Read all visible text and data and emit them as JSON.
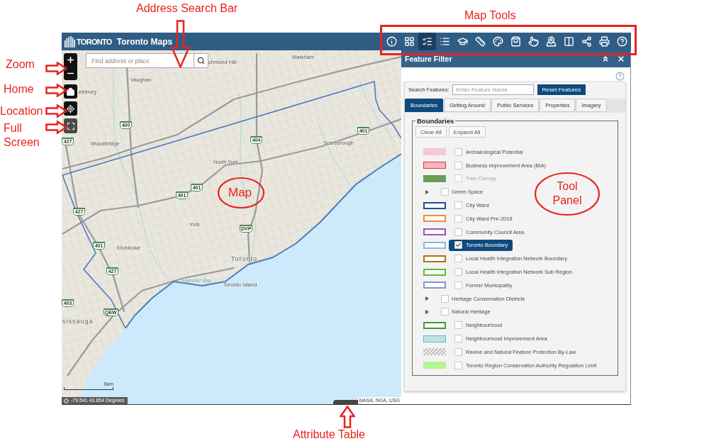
{
  "annotations": {
    "address_search_bar": "Address Search Bar",
    "map_tools": "Map Tools",
    "zoom": "Zoom",
    "home": "Home",
    "location": "Location",
    "full_screen": "Full Screen",
    "map": "Map",
    "tool_panel": "Tool Panel",
    "attribute_table": "Attribute Table"
  },
  "header": {
    "logo": "TORONTO",
    "title": "Toronto Maps",
    "tools": [
      {
        "selected": false
      },
      {
        "selected": false
      },
      {
        "selected": true
      },
      {
        "selected": false
      },
      {
        "selected": false
      },
      {
        "selected": false
      },
      {
        "selected": false
      },
      {
        "selected": false
      },
      {
        "selected": false
      },
      {
        "selected": false
      },
      {
        "selected": false
      },
      {
        "selected": false
      },
      {
        "selected": false
      },
      {
        "selected": false
      }
    ]
  },
  "map": {
    "search": {
      "placeholder": "Find address or place"
    },
    "labels": [
      {
        "text": "chmond Hill",
        "kind": "place"
      },
      {
        "text": "Markham",
        "kind": "place"
      },
      {
        "text": "Vaughan",
        "kind": "place"
      },
      {
        "text": "einburg",
        "kind": "place"
      },
      {
        "text": "Woodbridge",
        "kind": "place"
      },
      {
        "text": "North York",
        "kind": "place"
      },
      {
        "text": "Scarborough",
        "kind": "place"
      },
      {
        "text": "York",
        "kind": "place"
      },
      {
        "text": "Etobicoke",
        "kind": "place"
      },
      {
        "text": "Toronto",
        "kind": "city"
      },
      {
        "text": "Humber Bay",
        "kind": "water"
      },
      {
        "text": "Toronto Island",
        "kind": "place"
      },
      {
        "text": "sissauga",
        "kind": "city"
      }
    ],
    "shields": [
      {
        "text": "400"
      },
      {
        "text": "427"
      },
      {
        "text": "404"
      },
      {
        "text": "401"
      },
      {
        "text": "401"
      },
      {
        "text": "401"
      },
      {
        "text": "427"
      },
      {
        "text": "401"
      },
      {
        "text": "427"
      },
      {
        "text": "DVP"
      },
      {
        "text": "403"
      },
      {
        "text": "QEW"
      }
    ],
    "scale": "6km",
    "coordinates": "-79.541 43.854 Degrees",
    "attribution": "NASA, NGA, USG"
  },
  "feature_filter": {
    "title": "Feature Filter",
    "search_label": "Search Features:",
    "search": {
      "placeholder": "Enter Feature Name"
    },
    "reset_button": "Reset Features",
    "tabs": [
      {
        "label": "Boundaries",
        "selected": true
      },
      {
        "label": "Getting Around",
        "selected": false
      },
      {
        "label": "Public Services",
        "selected": false
      },
      {
        "label": "Properties",
        "selected": false
      },
      {
        "label": "Imagery",
        "selected": false
      }
    ],
    "section": {
      "legend": "Boundaries",
      "buttons": [
        "Clear All",
        "Expand All"
      ],
      "layers": [
        {
          "kind": "layer",
          "label": "Archaeological Potential",
          "swatch": {
            "kind": "fill",
            "color": "#f6c6dd"
          },
          "checked": false,
          "disabled": false
        },
        {
          "kind": "layer",
          "label": "Business Improvement Area (BIA)",
          "swatch": {
            "kind": "fill",
            "color": "#f7b4b9",
            "border": {
              "color": "#e0353c"
            }
          },
          "checked": false,
          "disabled": false
        },
        {
          "kind": "layer",
          "label": "Tree Canopy",
          "swatch": {
            "kind": "fill",
            "color": "#6a9c55"
          },
          "checked": false,
          "disabled": true
        },
        {
          "kind": "group",
          "label": "Green Space",
          "checked": false,
          "disabled": false,
          "expanded": false
        },
        {
          "kind": "layer",
          "label": "City Ward",
          "swatch": {
            "kind": "outline",
            "color": "#1d4f9c"
          },
          "checked": false,
          "disabled": false
        },
        {
          "kind": "layer",
          "label": "City Ward Pre-2018",
          "swatch": {
            "kind": "outline",
            "color": "#f58a35"
          },
          "checked": false,
          "disabled": false
        },
        {
          "kind": "layer",
          "label": "Community Council Area",
          "swatch": {
            "kind": "outline",
            "color": "#9b52b6"
          },
          "checked": false,
          "disabled": false
        },
        {
          "kind": "layer",
          "label": "Toronto Boundary",
          "swatch": {
            "kind": "outline",
            "color": "#8eb6e2"
          },
          "checked": true,
          "disabled": false
        },
        {
          "kind": "layer",
          "label": "Local Health Integration Network Boundary",
          "swatch": {
            "kind": "outline",
            "color": "#a9730f"
          },
          "checked": false,
          "disabled": false
        },
        {
          "kind": "layer",
          "label": "Local Health Integration Network Sub Region",
          "swatch": {
            "kind": "outline",
            "color": "#5cbd2c"
          },
          "checked": false,
          "disabled": false
        },
        {
          "kind": "layer",
          "label": "Former Municipality",
          "swatch": {
            "kind": "outline",
            "color": "#8398c9"
          },
          "checked": false,
          "disabled": false
        },
        {
          "kind": "group",
          "label": "Heritage Conservation Districts",
          "checked": false,
          "disabled": false,
          "expanded": false
        },
        {
          "kind": "group",
          "label": "Natural Heritage",
          "checked": false,
          "disabled": false,
          "expanded": false
        },
        {
          "kind": "layer",
          "label": "Neighbourhood",
          "swatch": {
            "kind": "outline",
            "color": "#3c9b3c"
          },
          "checked": false,
          "disabled": false
        },
        {
          "kind": "layer",
          "label": "Neighbourhood Improvement Area",
          "swatch": {
            "kind": "fill",
            "color": "#bfe4dd",
            "border": {
              "color": "#5cb6e4"
            }
          },
          "checked": false,
          "disabled": false
        },
        {
          "kind": "layer",
          "label": "Ravine and Natural Feature Protection By-Law",
          "swatch": {
            "kind": "hatch",
            "color": "#b3b3b3"
          },
          "checked": false,
          "disabled": false
        },
        {
          "kind": "layer",
          "label": "Toronto Region Conservation Authority Regulation Limit",
          "swatch": {
            "kind": "fill",
            "color": "#b2f78e"
          },
          "checked": false,
          "disabled": false
        }
      ]
    }
  }
}
